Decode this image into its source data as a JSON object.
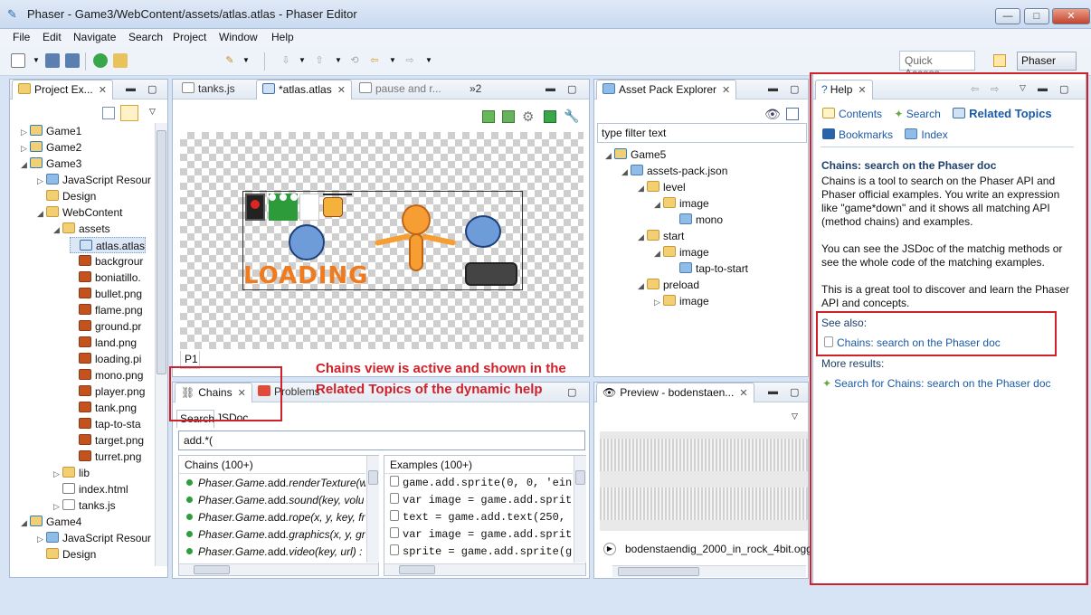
{
  "window": {
    "title": "Phaser - Game3/WebContent/assets/atlas.atlas - Phaser Editor",
    "minimize": "—",
    "maximize": "□",
    "close": "✕"
  },
  "menu": [
    "File",
    "Edit",
    "Navigate",
    "Search",
    "Project",
    "Window",
    "Help"
  ],
  "toolbar": {
    "quick_access": "Quick Access",
    "perspective": "Phaser"
  },
  "project_explorer": {
    "tab": "Project Ex...",
    "tree": [
      {
        "label": "Game1",
        "indent": 0,
        "icon": "proj",
        "arrow": "▷"
      },
      {
        "label": "Game2",
        "indent": 0,
        "icon": "proj",
        "arrow": "▷"
      },
      {
        "label": "Game3",
        "indent": 0,
        "icon": "proj",
        "arrow": "◢"
      },
      {
        "label": "JavaScript Resour",
        "indent": 1,
        "icon": "pkg",
        "arrow": "▷"
      },
      {
        "label": "Design",
        "indent": 1,
        "icon": "folder",
        "arrow": ""
      },
      {
        "label": "WebContent",
        "indent": 1,
        "icon": "folder",
        "arrow": "◢"
      },
      {
        "label": "assets",
        "indent": 2,
        "icon": "folder",
        "arrow": "◢"
      },
      {
        "label": "atlas.atlas",
        "indent": 3,
        "icon": "atlas",
        "arrow": "",
        "selected": true
      },
      {
        "label": "backgrour",
        "indent": 3,
        "icon": "file",
        "arrow": ""
      },
      {
        "label": "boniatillo.",
        "indent": 3,
        "icon": "file",
        "arrow": ""
      },
      {
        "label": "bullet.png",
        "indent": 3,
        "icon": "file",
        "arrow": ""
      },
      {
        "label": "flame.png",
        "indent": 3,
        "icon": "file",
        "arrow": ""
      },
      {
        "label": "ground.pr",
        "indent": 3,
        "icon": "file",
        "arrow": ""
      },
      {
        "label": "land.png",
        "indent": 3,
        "icon": "file",
        "arrow": ""
      },
      {
        "label": "loading.pi",
        "indent": 3,
        "icon": "file",
        "arrow": ""
      },
      {
        "label": "mono.png",
        "indent": 3,
        "icon": "file",
        "arrow": ""
      },
      {
        "label": "player.png",
        "indent": 3,
        "icon": "file",
        "arrow": ""
      },
      {
        "label": "tank.png",
        "indent": 3,
        "icon": "file",
        "arrow": ""
      },
      {
        "label": "tap-to-sta",
        "indent": 3,
        "icon": "file",
        "arrow": ""
      },
      {
        "label": "target.png",
        "indent": 3,
        "icon": "file",
        "arrow": ""
      },
      {
        "label": "turret.png",
        "indent": 3,
        "icon": "file",
        "arrow": ""
      },
      {
        "label": "lib",
        "indent": 2,
        "icon": "folder",
        "arrow": "▷"
      },
      {
        "label": "index.html",
        "indent": 2,
        "icon": "html",
        "arrow": ""
      },
      {
        "label": "tanks.js",
        "indent": 2,
        "icon": "js",
        "arrow": "▷"
      },
      {
        "label": "Game4",
        "indent": 0,
        "icon": "proj",
        "arrow": "◢"
      },
      {
        "label": "JavaScript Resour",
        "indent": 1,
        "icon": "pkg",
        "arrow": "▷"
      },
      {
        "label": "Design",
        "indent": 1,
        "icon": "folder",
        "arrow": ""
      }
    ]
  },
  "editor": {
    "tabs": [
      "tanks.js",
      "*atlas.atlas",
      "pause and r...",
      "»2"
    ],
    "page_tab": "P1",
    "loading_text": "LOADING"
  },
  "asset_pack": {
    "tab": "Asset Pack Explorer",
    "filter_placeholder": "type filter text",
    "tree": [
      {
        "label": "Game5",
        "indent": 0,
        "icon": "proj",
        "arrow": "◢"
      },
      {
        "label": "assets-pack.json",
        "indent": 1,
        "icon": "pkg",
        "arrow": "◢"
      },
      {
        "label": "level",
        "indent": 2,
        "icon": "folder",
        "arrow": "◢"
      },
      {
        "label": "image",
        "indent": 3,
        "icon": "folder",
        "arrow": "◢"
      },
      {
        "label": "mono",
        "indent": 4,
        "icon": "pkg",
        "arrow": ""
      },
      {
        "label": "start",
        "indent": 2,
        "icon": "folder",
        "arrow": "◢"
      },
      {
        "label": "image",
        "indent": 3,
        "icon": "folder",
        "arrow": "◢"
      },
      {
        "label": "tap-to-start",
        "indent": 4,
        "icon": "pkg",
        "arrow": ""
      },
      {
        "label": "preload",
        "indent": 2,
        "icon": "folder",
        "arrow": "◢"
      },
      {
        "label": "image",
        "indent": 3,
        "icon": "folder",
        "arrow": "▷"
      }
    ]
  },
  "chains": {
    "tabs": [
      "Chains",
      "Problems"
    ],
    "subtabs": [
      "Search",
      "JSDoc"
    ],
    "query": "add.*(",
    "chains_header": "Chains (100+)",
    "examples_header": "Examples (100+)",
    "chain_rows": [
      {
        "pre": "Phaser.Game.",
        "method": "add",
        "post": ".renderTexture(w"
      },
      {
        "pre": "Phaser.Game.",
        "method": "add",
        "post": ".sound(key, volu"
      },
      {
        "pre": "Phaser.Game.",
        "method": "add",
        "post": ".rope(x, y, key, fr"
      },
      {
        "pre": "Phaser.Game.",
        "method": "add",
        "post": ".graphics(x, y, gr"
      },
      {
        "pre": "Phaser.Game.",
        "method": "add",
        "post": ".video(key, url) :"
      }
    ],
    "example_rows": [
      "game.add.sprite(0, 0, 'einste",
      "var image = game.add.sprite(g",
      "text = game.add.text(250, 16",
      "var image = game.add.sprite(0",
      "sprite = game.add.sprite(game"
    ]
  },
  "preview": {
    "tab": "Preview - bodenstaen...",
    "file": "bodenstaendig_2000_in_rock_4bit.ogg"
  },
  "help": {
    "tab": "Help",
    "links": [
      "Contents",
      "Search",
      "Related Topics",
      "Bookmarks",
      "Index"
    ],
    "heading": "Chains: search on the Phaser doc",
    "para1": "Chains is a tool to search on the Phaser API and Phaser official examples. You write an expression like \"game*down\" and it shows all matching API (method chains) and examples.",
    "para2": "You can see the JSDoc of the matchig methods or see the whole code of the matching examples.",
    "para3": "This is a great tool to discover and learn the Phaser API and concepts.",
    "see_also": "See also:",
    "see_also_link": "Chains: search on the Phaser doc",
    "more_results": "More results:",
    "more_link": "Search for Chains: search on the Phaser doc"
  },
  "annotation": {
    "line1": "Chains view is active and shown in the",
    "line2": "Related Topics of the dynamic help"
  },
  "colors": {
    "annotation_red": "#d0212a",
    "link_blue": "#1b5aa8",
    "loading_orange": "#f07a1e"
  }
}
